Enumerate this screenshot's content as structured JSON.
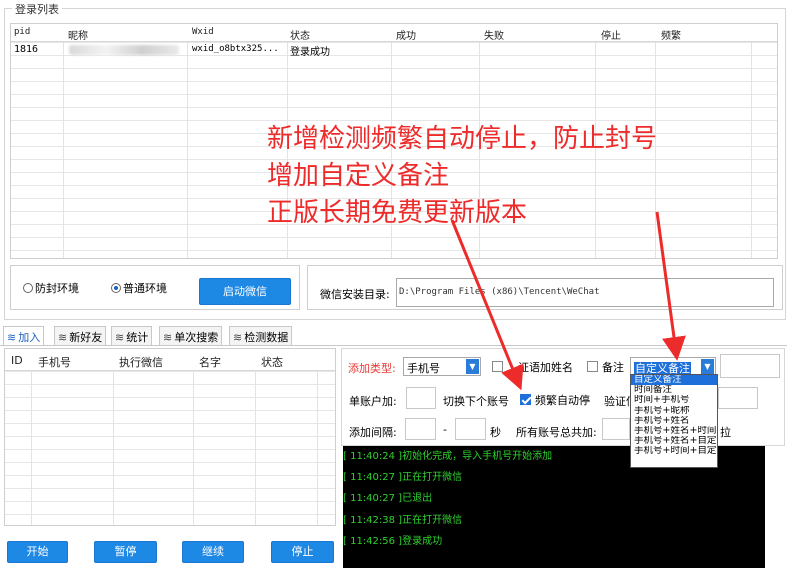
{
  "login_group": {
    "title": "登录列表",
    "columns": [
      "pid",
      "昵称",
      "Wxid",
      "状态",
      "成功",
      "失败",
      "停止",
      "频繁"
    ],
    "rows": [
      {
        "pid": "1816",
        "nickname": "",
        "wxid": "wxid_o8btx325...",
        "status": "登录成功",
        "success": "",
        "fail": "",
        "stop": "",
        "freq": ""
      }
    ]
  },
  "env": {
    "anti_ban_label": "防封环境",
    "normal_label": "普通环境",
    "selected": "normal",
    "start_wechat_label": "启动微信",
    "install_dir_label": "微信安装目录:",
    "install_dir_value": "D:\\Program Files (x86)\\Tencent\\WeChat"
  },
  "tabs": [
    {
      "label": "加入",
      "active": true
    },
    {
      "label": "新好友",
      "active": false
    },
    {
      "label": "统计",
      "active": false
    },
    {
      "label": "单次搜索",
      "active": false
    },
    {
      "label": "检测数据",
      "active": false
    }
  ],
  "task_table": {
    "columns": [
      "ID",
      "手机号",
      "执行微信",
      "名字",
      "状态"
    ]
  },
  "bottom_buttons": {
    "start": "开始",
    "pause": "暂停",
    "continue": "继续",
    "stop": "停止"
  },
  "settings": {
    "add_type_label": "添加类型:",
    "add_type_value": "手机号",
    "verify_name_label": "证语加姓名",
    "note_label": "备注",
    "note_type_value": "自定义备注",
    "single_account_label": "单账户加:",
    "switch_next_label": "切换下个账号",
    "freq_stop_label": "频繁自动停",
    "freq_stop_checked": true,
    "verify_label": "验证信",
    "interval_label": "添加间隔:",
    "dash": "-",
    "sec_label": "秒",
    "total_label": "所有账号总共加:",
    "tail_char": "拉",
    "dropdown_options": [
      "自定义备注",
      "时间备注",
      "时间+手机号",
      "手机号+昵称",
      "手机号+姓名",
      "手机号+姓名+时间",
      "手机号+姓名+自定",
      "手机号+时间+自定"
    ]
  },
  "log_lines": [
    "[ 11:40:24 ]初始化完成，导入手机号开始添加",
    "[ 11:40:27 ]正在打开微信",
    "[ 11:40:27 ]已退出",
    "[ 11:42:38 ]正在打开微信",
    "[ 11:42:56 ]登录成功"
  ],
  "annotation": {
    "line1": "新增检测频繁自动停止，防止封号",
    "line2": "增加自定义备注",
    "line3": "正版长期免费更新版本",
    "color": "#ee2b2b"
  }
}
